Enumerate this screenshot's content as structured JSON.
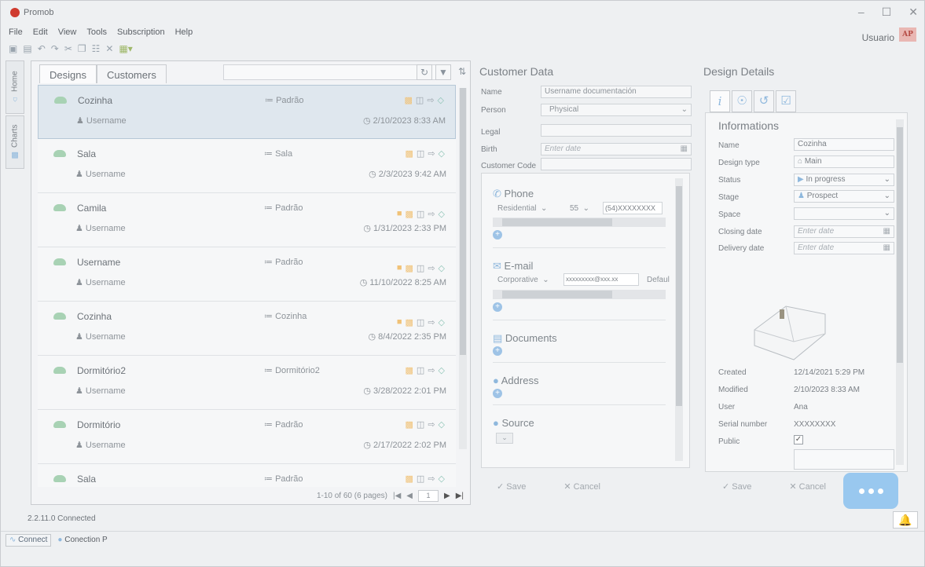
{
  "window": {
    "title": "Promob",
    "user": "Usuario",
    "avatar": "AP"
  },
  "menu": [
    "File",
    "Edit",
    "View",
    "Tools",
    "Subscription",
    "Help"
  ],
  "sidetabs": [
    "Home",
    "Charts"
  ],
  "designs": {
    "tabs": [
      "Designs",
      "Customers"
    ],
    "items": [
      {
        "name": "Cozinha",
        "user": "Username",
        "space": "Padrão",
        "date": "2/10/2023 8:33 AM",
        "selected": true,
        "customer_icon": false
      },
      {
        "name": "Sala",
        "user": "Username",
        "space": "Sala",
        "date": "2/3/2023 9:42 AM",
        "selected": false,
        "customer_icon": false
      },
      {
        "name": "Camila",
        "user": "Username",
        "space": "Padrão",
        "date": "1/31/2023 2:33 PM",
        "selected": false,
        "customer_icon": true
      },
      {
        "name": "Username",
        "user": "Username",
        "space": "Padrão",
        "date": "11/10/2022 8:25 AM",
        "selected": false,
        "customer_icon": true
      },
      {
        "name": "Cozinha",
        "user": "Username",
        "space": "Cozinha",
        "date": "8/4/2022 2:35 PM",
        "selected": false,
        "customer_icon": true
      },
      {
        "name": "Dormitório2",
        "user": "Username",
        "space": "Dormitório2",
        "date": "3/28/2022 2:01 PM",
        "selected": false,
        "customer_icon": false
      },
      {
        "name": "Dormitório",
        "user": "Username",
        "space": "Padrão",
        "date": "2/17/2022 2:02 PM",
        "selected": false,
        "customer_icon": false
      },
      {
        "name": "Sala",
        "user": "",
        "space": "Padrão",
        "date": "",
        "selected": false,
        "customer_icon": false
      }
    ],
    "pager_text": "1-10 of 60 (6 pages)",
    "page_input": "1"
  },
  "customer": {
    "title": "Customer Data",
    "name_label": "Name",
    "name_value": "Username documentación",
    "person_label": "Person",
    "person_value": "Physical",
    "legal_label": "Legal",
    "birth_label": "Birth",
    "birth_placeholder": "Enter date",
    "code_label": "Customer Code",
    "phone_title": "Phone",
    "phone_type": "Residential",
    "phone_code": "55",
    "phone_number": "(54)XXXXXXXX",
    "email_title": "E-mail",
    "email_type": "Corporative",
    "email_value": "xxxxxxxxx@xxx.xx",
    "email_default": "Defaul",
    "documents_title": "Documents",
    "address_title": "Address",
    "source_title": "Source",
    "save": "Save",
    "cancel": "Cancel"
  },
  "details": {
    "title": "Design Details",
    "section": "Informations",
    "fields": {
      "name_label": "Name",
      "name_value": "Cozinha",
      "type_label": "Design type",
      "type_value": "Main",
      "status_label": "Status",
      "status_value": "In progress",
      "stage_label": "Stage",
      "stage_value": "Prospect",
      "space_label": "Space",
      "closing_label": "Closing date",
      "closing_placeholder": "Enter date",
      "delivery_label": "Delivery date",
      "delivery_placeholder": "Enter date"
    },
    "meta": {
      "created_label": "Created",
      "created_value": "12/14/2021 5:29 PM",
      "modified_label": "Modified",
      "modified_value": "2/10/2023 8:33 AM",
      "user_label": "User",
      "user_value": "Ana",
      "serial_label": "Serial number",
      "serial_value": "XXXXXXXX",
      "public_label": "Public"
    },
    "save": "Save",
    "cancel": "Cancel"
  },
  "status": {
    "version": "2.2.11.0 Connected",
    "connect": "Connect",
    "connection": "Conection P"
  },
  "colors": {
    "accent": "#99c8ef",
    "selected_row": "#dfe7ee"
  }
}
